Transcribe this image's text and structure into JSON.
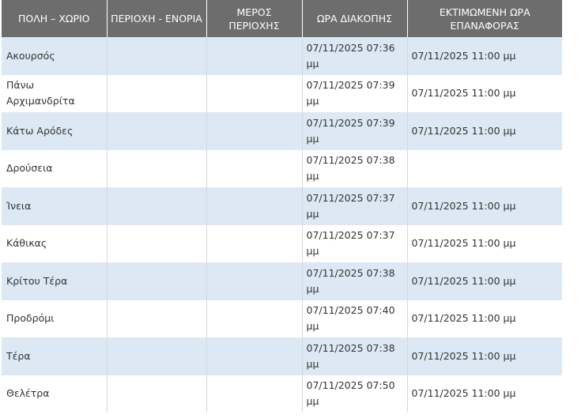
{
  "table": {
    "headers": [
      "ΠΟΛΗ – ΧΩΡΙΟ",
      "ΠΕΡΙΟΧΗ - ΕΝΟΡΙΑ",
      "ΜΕΡΟΣ ΠΕΡΙΟΧΗΣ",
      "ΩΡΑ ΔΙΑΚΟΠΗΣ",
      "ΕΚΤΙΜΩΜΕΝΗ ΩΡΑ ΕΠΑΝΑΦΟΡΑΣ"
    ],
    "rows": [
      {
        "town": "Ακουρσός",
        "area": "",
        "part": "",
        "outage_time": "07/11/2025 07:36 μμ",
        "restore_time": "07/11/2025 11:00 μμ"
      },
      {
        "town": "Πάνω Αρχιμανδρίτα",
        "area": "",
        "part": "",
        "outage_time": "07/11/2025 07:39 μμ",
        "restore_time": "07/11/2025 11:00 μμ"
      },
      {
        "town": "Κάτω Αρόδες",
        "area": "",
        "part": "",
        "outage_time": "07/11/2025 07:39 μμ",
        "restore_time": "07/11/2025 11:00 μμ"
      },
      {
        "town": "Δρούσεια",
        "area": "",
        "part": "",
        "outage_time": "07/11/2025 07:38 μμ",
        "restore_time": ""
      },
      {
        "town": "Ίνεια",
        "area": "",
        "part": "",
        "outage_time": "07/11/2025 07:37 μμ",
        "restore_time": "07/11/2025 11:00 μμ"
      },
      {
        "town": "Κάθικας",
        "area": "",
        "part": "",
        "outage_time": "07/11/2025 07:37 μμ",
        "restore_time": "07/11/2025 11:00 μμ"
      },
      {
        "town": "Κρίτου Τέρα",
        "area": "",
        "part": "",
        "outage_time": "07/11/2025 07:38 μμ",
        "restore_time": "07/11/2025 11:00 μμ"
      },
      {
        "town": "Προδρόμι",
        "area": "",
        "part": "",
        "outage_time": "07/11/2025 07:40 μμ",
        "restore_time": "07/11/2025 11:00 μμ"
      },
      {
        "town": "Τέρα",
        "area": "",
        "part": "",
        "outage_time": "07/11/2025 07:38 μμ",
        "restore_time": "07/11/2025 11:00 μμ"
      },
      {
        "town": "Θελέτρα",
        "area": "",
        "part": "",
        "outage_time": "07/11/2025 07:50 μμ",
        "restore_time": "07/11/2025 11:00 μμ"
      }
    ]
  },
  "colors": {
    "header_bg": "#6d6d6d",
    "header_text": "#ffffff",
    "row_alt_bg": "#dce9f4",
    "row_bg": "#ffffff",
    "cell_text": "#333333"
  }
}
